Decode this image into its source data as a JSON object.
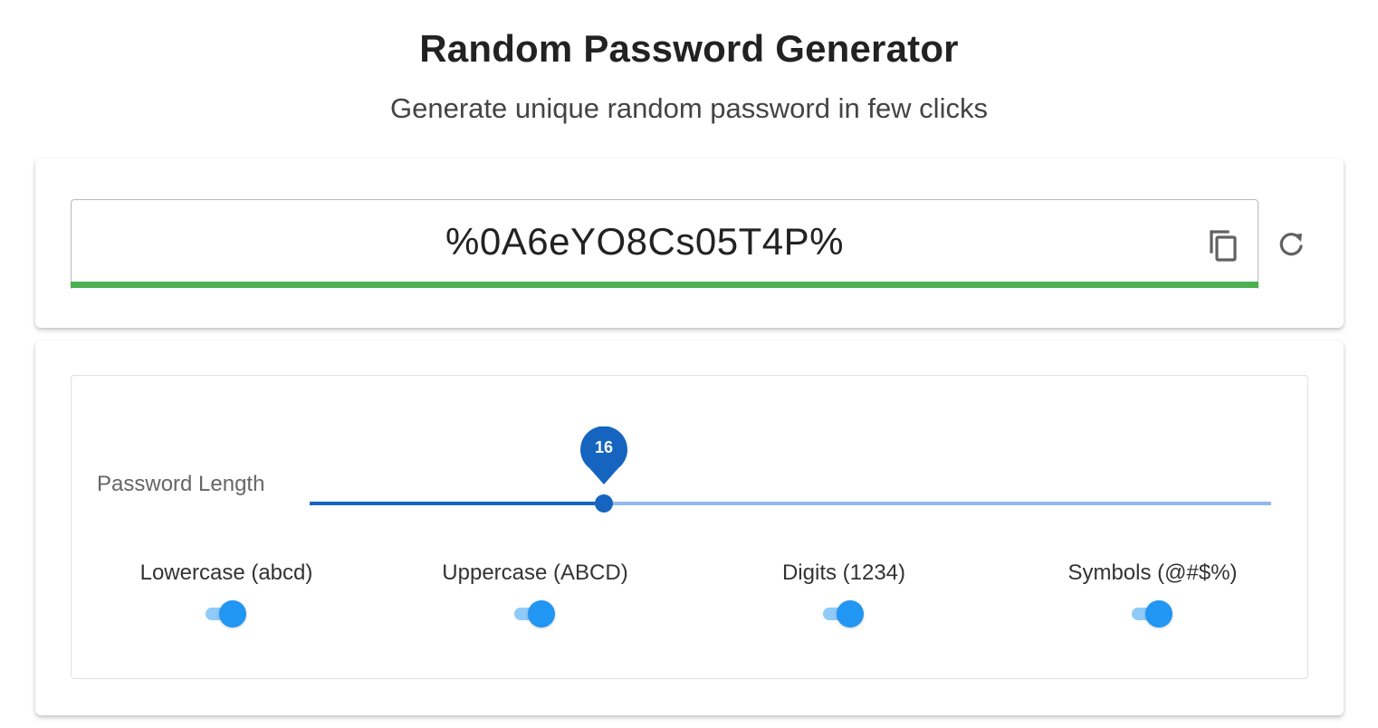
{
  "header": {
    "title": "Random Password Generator",
    "subtitle": "Generate unique random password in few clicks"
  },
  "password": {
    "value": "%0A6eYO8Cs05T4P%",
    "strength_color": "#4caf50",
    "copy_icon": "copy-icon",
    "refresh_icon": "refresh-icon"
  },
  "options": {
    "length": {
      "label": "Password Length",
      "value": 16,
      "value_text": "16",
      "fraction": 0.306,
      "active_color": "#1565c0",
      "inactive_color": "#90b9ef"
    },
    "toggles": [
      {
        "label": "Lowercase (abcd)",
        "checked": true
      },
      {
        "label": "Uppercase (ABCD)",
        "checked": true
      },
      {
        "label": "Digits (1234)",
        "checked": true
      },
      {
        "label": "Symbols (@#$%)",
        "checked": true
      }
    ],
    "toggle_color": "#2196f3"
  }
}
